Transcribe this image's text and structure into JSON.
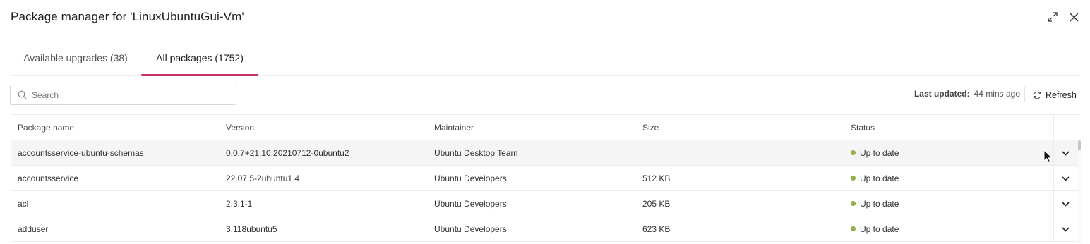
{
  "dialog": {
    "title": "Package manager for 'LinuxUbuntuGui-Vm'",
    "expand_icon": "expand-icon",
    "close_icon": "close-icon"
  },
  "tabs": [
    {
      "label": "Available upgrades (38)",
      "active": false
    },
    {
      "label": "All packages (1752)",
      "active": true
    }
  ],
  "search": {
    "placeholder": "Search",
    "value": ""
  },
  "toolbar": {
    "last_updated_label": "Last updated:",
    "last_updated_value": "44 mins ago",
    "refresh_label": "Refresh"
  },
  "table": {
    "columns": [
      "Package name",
      "Version",
      "Maintainer",
      "Size",
      "Status"
    ],
    "rows": [
      {
        "name": "accountsservice-ubuntu-schemas",
        "version": "0.0.7+21.10.20210712-0ubuntu2",
        "maintainer": "Ubuntu Desktop Team",
        "size": "",
        "status": "Up to date"
      },
      {
        "name": "accountsservice",
        "version": "22.07.5-2ubuntu1.4",
        "maintainer": "Ubuntu Developers",
        "size": "512 KB",
        "status": "Up to date"
      },
      {
        "name": "acl",
        "version": "2.3.1-1",
        "maintainer": "Ubuntu Developers",
        "size": "205 KB",
        "status": "Up to date"
      },
      {
        "name": "adduser",
        "version": "3.118ubuntu5",
        "maintainer": "Ubuntu Developers",
        "size": "623 KB",
        "status": "Up to date"
      }
    ]
  },
  "colors": {
    "accent": "#c8336d",
    "status_ok": "#8fb04a"
  }
}
